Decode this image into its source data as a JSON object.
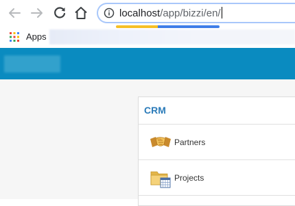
{
  "browser": {
    "url_host": "localhost",
    "url_path": "/app/bizzi/en/",
    "bookmarks": {
      "apps_label": "Apps"
    },
    "icons": [
      "back-icon",
      "forward-icon",
      "reload-icon",
      "home-icon",
      "info-icon",
      "apps-grid-icon"
    ]
  },
  "crm": {
    "title": "CRM",
    "items": [
      {
        "label": "Partners",
        "icon": "handshake-icon"
      },
      {
        "label": "Projects",
        "icon": "folder-calendar-icon"
      }
    ]
  },
  "colors": {
    "header": "#0a8bc0",
    "title": "#2b7bb9",
    "omnibox_border": "#a8c7fa"
  }
}
